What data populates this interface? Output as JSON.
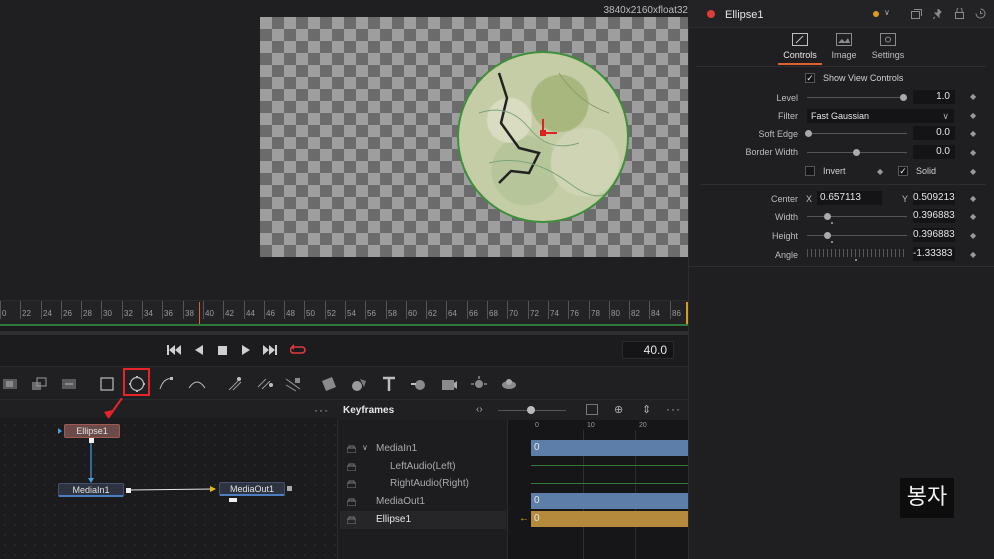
{
  "viewer": {
    "resolution": "3840x2160xfloat32"
  },
  "ruler": {
    "ticks": [
      "0",
      "22",
      "24",
      "26",
      "28",
      "30",
      "32",
      "34",
      "36",
      "38",
      "40",
      "42",
      "44",
      "46",
      "48",
      "50",
      "52",
      "54",
      "56",
      "58",
      "60",
      "62",
      "64",
      "66",
      "68",
      "70",
      "72",
      "74",
      "76",
      "78",
      "80",
      "82",
      "84",
      "86"
    ]
  },
  "transport": {
    "frame": "40.0"
  },
  "nodes": {
    "ellipse": "Ellipse1",
    "media_in": "MediaIn1",
    "media_out": "MediaOut1"
  },
  "keyframes": {
    "title": "Keyframes",
    "ruler": [
      "0",
      "10",
      "20"
    ],
    "tracks": [
      "MediaIn1",
      "LeftAudio(Left)",
      "RightAudio(Right)",
      "MediaOut1",
      "Ellipse1"
    ],
    "values": [
      "0",
      "0",
      "0"
    ]
  },
  "inspector": {
    "title": "Ellipse1",
    "tabs": [
      "Controls",
      "Image",
      "Settings"
    ],
    "show_view_controls": "Show View Controls",
    "level_label": "Level",
    "level_value": "1.0",
    "filter_label": "Filter",
    "filter_value": "Fast Gaussian",
    "soft_edge_label": "Soft Edge",
    "soft_edge_value": "0.0",
    "border_width_label": "Border Width",
    "border_width_value": "0.0",
    "invert_label": "Invert",
    "solid_label": "Solid",
    "center_label": "Center",
    "center_x_label": "X",
    "center_x": "0.657113",
    "center_y_label": "Y",
    "center_y": "0.509213",
    "width_label": "Width",
    "width_value": "0.396883",
    "height_label": "Height",
    "height_value": "0.396883",
    "angle_label": "Angle",
    "angle_value": "-1.33383"
  },
  "watermark": "봉자",
  "colors": {
    "accent": "#e0612d",
    "node_red": "#e8232a",
    "ellipse_green": "#3d8f3a"
  }
}
